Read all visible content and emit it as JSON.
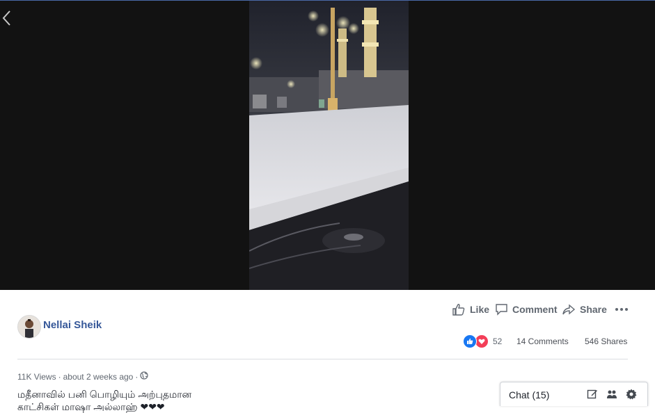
{
  "post": {
    "author": "Nellai Sheik",
    "actions": {
      "like": "Like",
      "comment": "Comment",
      "share": "Share"
    },
    "reaction_count": "52",
    "comments": "14 Comments",
    "shares": "546 Shares",
    "views": "11K Views",
    "time": "about 2 weeks ago",
    "separator": "·",
    "caption_line1": "மதீனாவில் பனி பொழியும் அற்புதமான",
    "caption_line2": "காட்சிகள் மாஷா அல்லாஹ் ❤❤❤"
  },
  "chat": {
    "label": "Chat (15)"
  },
  "colors": {
    "link": "#365899",
    "like_blue": "#1877f2",
    "love_red": "#f33e58",
    "video_bg": "#121212"
  },
  "icons": [
    "back-arrow-icon",
    "like-icon",
    "comment-icon",
    "share-icon",
    "more-icon",
    "globe-icon",
    "compose-icon",
    "people-icon",
    "gear-icon"
  ]
}
